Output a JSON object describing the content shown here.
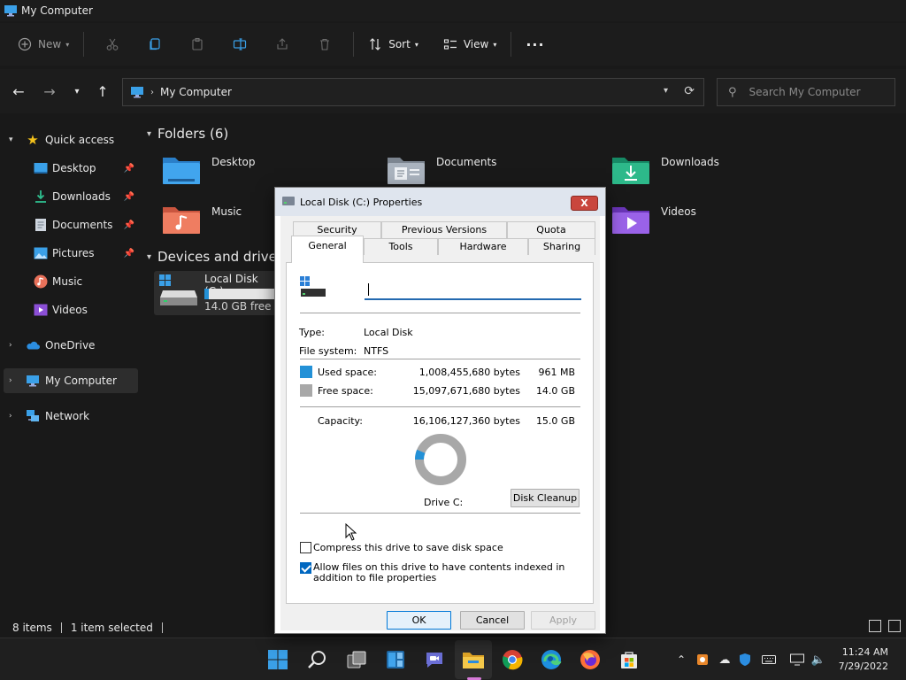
{
  "window": {
    "title": "My Computer"
  },
  "commandbar": {
    "new_label": "New",
    "sort_label": "Sort",
    "view_label": "View"
  },
  "address": {
    "path": "My Computer"
  },
  "search": {
    "placeholder": "Search My Computer"
  },
  "sidebar": {
    "quick_access": "Quick access",
    "items": [
      {
        "label": "Desktop",
        "pinned": true
      },
      {
        "label": "Downloads",
        "pinned": true
      },
      {
        "label": "Documents",
        "pinned": true
      },
      {
        "label": "Pictures",
        "pinned": true
      },
      {
        "label": "Music",
        "pinned": false
      },
      {
        "label": "Videos",
        "pinned": false
      }
    ],
    "onedrive": "OneDrive",
    "my_computer": "My Computer",
    "network": "Network"
  },
  "content": {
    "folders_header": "Folders (6)",
    "folders": [
      {
        "label": "Desktop",
        "icon": "folder-desktop-icon"
      },
      {
        "label": "Documents",
        "icon": "folder-documents-icon"
      },
      {
        "label": "Downloads",
        "icon": "folder-downloads-icon"
      },
      {
        "label": "Music",
        "icon": "folder-music-icon"
      },
      {
        "label": "Videos",
        "icon": "folder-videos-icon"
      }
    ],
    "drives_header": "Devices and drives",
    "drive": {
      "name": "Local Disk (C:)",
      "free_text": "14.0 GB free of",
      "used_fraction": 0.063
    }
  },
  "statusbar": {
    "items": "8 items",
    "selected": "1 item selected"
  },
  "taskbar": {
    "time": "11:24 AM",
    "date": "7/29/2022"
  },
  "dialog": {
    "title": "Local Disk (C:) Properties",
    "close_label": "X",
    "tabs_top": [
      "Security",
      "Previous Versions",
      "Quota"
    ],
    "tabs_bottom": [
      "General",
      "Tools",
      "Hardware",
      "Sharing"
    ],
    "name_value": "",
    "type_label": "Type:",
    "type_value": "Local Disk",
    "fs_label": "File system:",
    "fs_value": "NTFS",
    "used_label": "Used space:",
    "used_bytes": "1,008,455,680 bytes",
    "used_size": "961 MB",
    "free_label": "Free space:",
    "free_bytes": "15,097,671,680 bytes",
    "free_size": "14.0 GB",
    "capacity_label": "Capacity:",
    "capacity_bytes": "16,106,127,360 bytes",
    "capacity_size": "15.0 GB",
    "drive_label": "Drive C:",
    "cleanup_label": "Disk Cleanup",
    "compress_label": "Compress this drive to save disk space",
    "compress_checked": false,
    "index_label": "Allow files on this drive to have contents indexed in addition to file properties",
    "index_checked": true,
    "ok_label": "OK",
    "cancel_label": "Cancel",
    "apply_label": "Apply",
    "used_fraction": 0.0626,
    "colors": {
      "used": "#2391d7",
      "free": "#a8a8a8"
    }
  }
}
